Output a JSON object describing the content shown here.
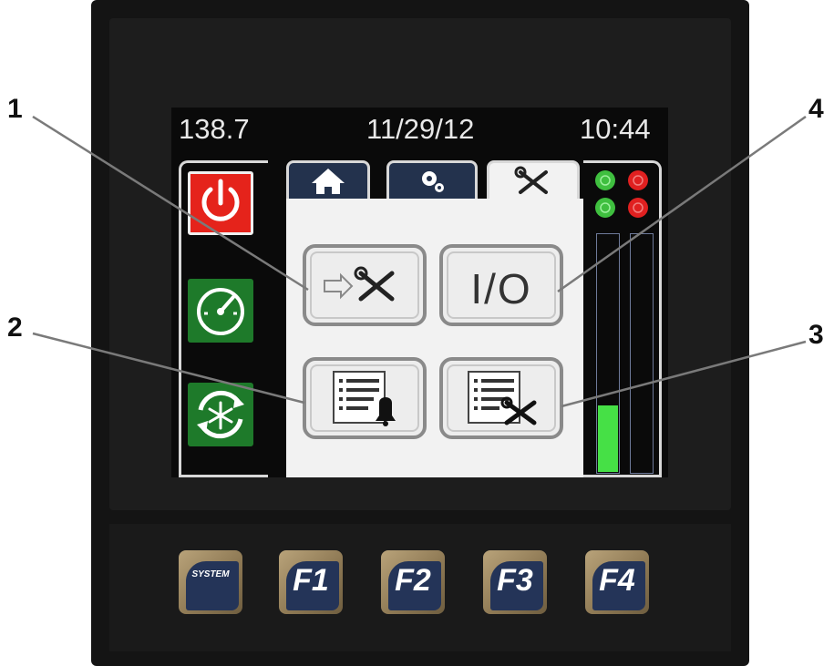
{
  "callouts": [
    "1",
    "2",
    "3",
    "4"
  ],
  "status_bar": {
    "value": "138.7",
    "date": "11/29/12",
    "time": "10:44"
  },
  "side_buttons": [
    {
      "icon": "power-icon",
      "color": "#e5231b"
    },
    {
      "icon": "gauge-icon",
      "color": "#1e7a2a"
    },
    {
      "icon": "defrost-snowflake-icon",
      "color": "#1e7a2a"
    }
  ],
  "tabs": [
    {
      "icon": "home-icon",
      "active": false
    },
    {
      "icon": "gears-icon",
      "active": false
    },
    {
      "icon": "tools-icon",
      "active": true
    }
  ],
  "menu_buttons": [
    {
      "icon": "arrow-tools-icon",
      "callout": "1"
    },
    {
      "label": "I/O",
      "callout": "4"
    },
    {
      "icon": "list-bell-icon",
      "callout": "2"
    },
    {
      "icon": "list-tools-icon",
      "callout": "3"
    }
  ],
  "indicators": {
    "left_column_color": "#3fbf3f",
    "right_column_color": "#e02020"
  },
  "level_bars": [
    {
      "fill": 0.28,
      "color": "#46e046"
    },
    {
      "fill": 0.0,
      "color": "#46e046"
    }
  ],
  "function_keys": [
    "SYSTEM",
    "F1",
    "F2",
    "F3",
    "F4"
  ]
}
